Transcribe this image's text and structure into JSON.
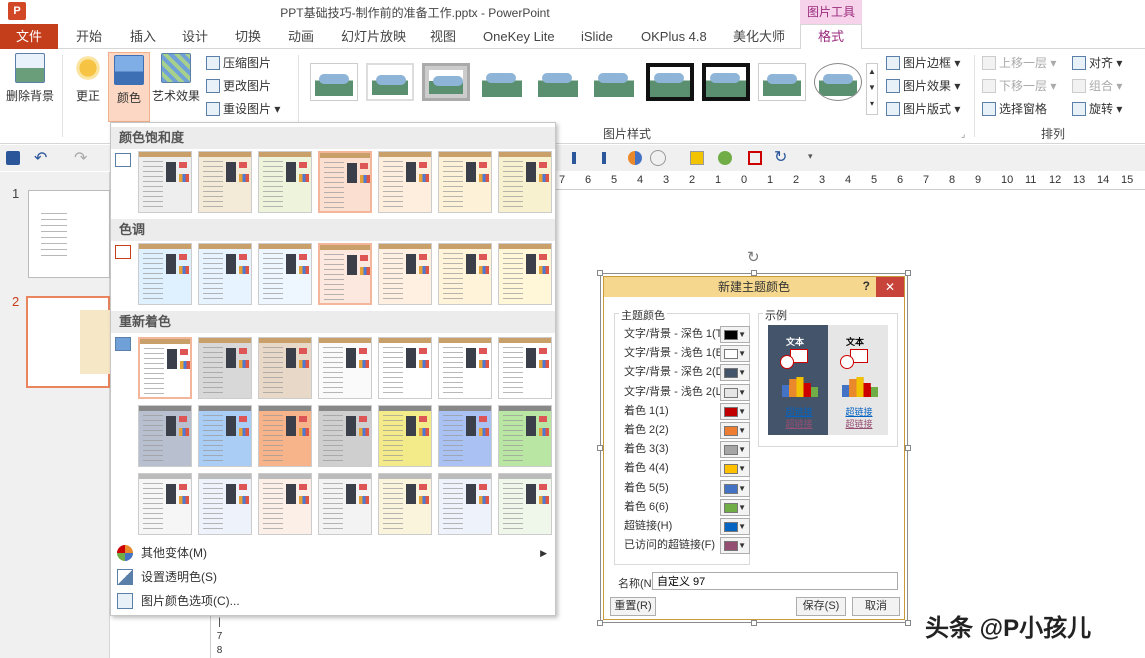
{
  "window": {
    "title": "PPT基础技巧-制作前的准备工作.pptx - PowerPoint",
    "context_tab_group": "图片工具"
  },
  "tabs": {
    "file": "文件",
    "items": [
      "开始",
      "插入",
      "设计",
      "切换",
      "动画",
      "幻灯片放映",
      "视图",
      "OneKey Lite",
      "iSlide",
      "OKPlus 4.8",
      "美化大师"
    ],
    "format": "格式"
  },
  "ribbon": {
    "remove_bg": "删除背景",
    "corrections": "更正",
    "color": "颜色",
    "artistic": "艺术效果",
    "compress": "压缩图片",
    "change_pic": "更改图片",
    "reset_pic": "重设图片",
    "border": "图片边框",
    "effects": "图片效果",
    "layout": "图片版式",
    "styles_label": "图片样式",
    "bring_forward": "上移一层",
    "send_backward": "下移一层",
    "selection_pane": "选择窗格",
    "align": "对齐",
    "group": "组合",
    "rotate": "旋转",
    "arrange_label": "排列"
  },
  "ruler": {
    "ticks": [
      "7",
      "6",
      "5",
      "4",
      "3",
      "2",
      "1",
      "0",
      "1",
      "2",
      "3",
      "4",
      "5",
      "6",
      "7",
      "8",
      "9",
      "10",
      "11",
      "12",
      "13",
      "14",
      "15"
    ]
  },
  "slides": {
    "numbers": [
      "1",
      "2"
    ]
  },
  "dropdown": {
    "saturation_header": "颜色饱和度",
    "tone_header": "色调",
    "recolor_header": "重新着色",
    "more_variants": "其他变体(M)",
    "set_transparent": "设置透明色(S)",
    "color_options": "图片颜色选项(C)...",
    "saturation_tints": [
      "#ffffff",
      "#eeeeee",
      "#f4ead8",
      "#eef4dc",
      "#fbe0d2",
      "#fdeede",
      "#fdf2d8",
      "#f8f1d0"
    ],
    "tone_tints": [
      "#dff1ff",
      "#e7f4ff",
      "#eef6ff",
      "#fde8e0",
      "#fff0e2",
      "#fff3da",
      "#fff7d8"
    ],
    "recolor_row1": [
      "#ffffff",
      "#d8d8d8",
      "#e8d8c8",
      "#fafafa",
      "#ffffff",
      "#ffffff",
      "#ffffff"
    ],
    "recolor_row2": [
      "#b8c0d0",
      "#a9cdf5",
      "#f7b48a",
      "#cfcfcf",
      "#f3ea8a",
      "#a9c2f3",
      "#b9e6a3"
    ],
    "recolor_row3": [
      "#f6f6f6",
      "#eef2fa",
      "#fbefe8",
      "#f3f3f3",
      "#fbf4dc",
      "#eef2fb",
      "#eff7ea"
    ]
  },
  "dialog": {
    "title": "新建主题颜色",
    "help": "?",
    "close": "✕",
    "theme_colors_legend": "主题颜色",
    "sample_legend": "示例",
    "rows": [
      {
        "label": "文字/背景 - 深色 1(T)",
        "color": "#000000"
      },
      {
        "label": "文字/背景 - 浅色 1(B)",
        "color": "#ffffff"
      },
      {
        "label": "文字/背景 - 深色 2(D)",
        "color": "#44546a"
      },
      {
        "label": "文字/背景 - 浅色 2(L)",
        "color": "#e7e6e6"
      },
      {
        "label": "着色 1(1)",
        "color": "#c00000"
      },
      {
        "label": "着色 2(2)",
        "color": "#ed7d31"
      },
      {
        "label": "着色 3(3)",
        "color": "#a5a5a5"
      },
      {
        "label": "着色 4(4)",
        "color": "#ffc000"
      },
      {
        "label": "着色 5(5)",
        "color": "#4472c4"
      },
      {
        "label": "着色 6(6)",
        "color": "#70ad47"
      },
      {
        "label": "超链接(H)",
        "color": "#0563c1"
      },
      {
        "label": "已访问的超链接(F)",
        "color": "#954f72"
      }
    ],
    "sample_text": "文本",
    "hyperlink": "超链接",
    "name_label": "名称(N):",
    "name_value": "自定义 97",
    "reset": "重置(R)",
    "save": "保存(S)",
    "cancel": "取消"
  },
  "watermark": "头条 @P小孩儿"
}
